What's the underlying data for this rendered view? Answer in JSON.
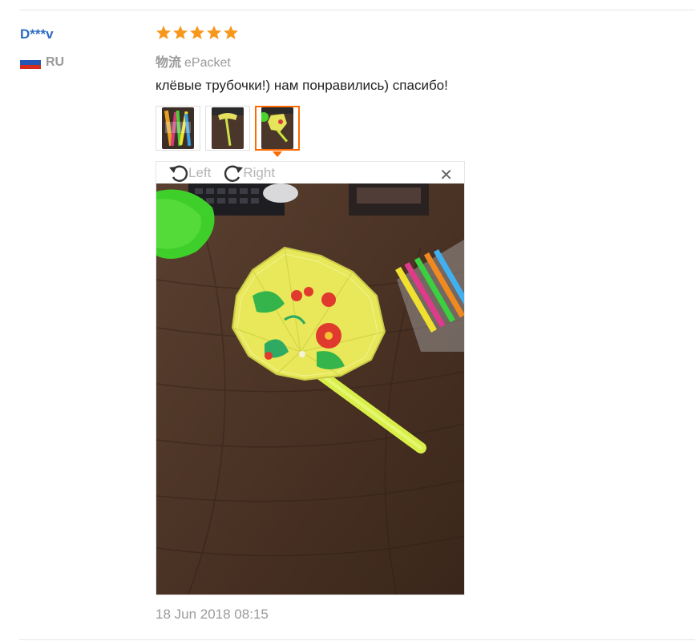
{
  "reviewer": {
    "name": "D***v",
    "country_code": "RU",
    "flag_colors": [
      "#ffffff",
      "#2457b3",
      "#d52b1e"
    ]
  },
  "review": {
    "rating": 5,
    "star_color": "#f7971c",
    "logistics_label": "物流",
    "logistics_value": "ePacket",
    "text": "клёвые трубочки!) нам понравились) спасибо!",
    "date": "18 Jun 2018 08:15"
  },
  "viewer": {
    "rotate_left_label": "Left",
    "rotate_right_label": "Right",
    "close_icon": "close-icon",
    "accent_color": "#ff6a00"
  },
  "thumbnails": [
    {
      "icon": "photo-thumbnail",
      "active": false
    },
    {
      "icon": "photo-thumbnail",
      "active": false
    },
    {
      "icon": "photo-thumbnail",
      "active": true
    }
  ]
}
